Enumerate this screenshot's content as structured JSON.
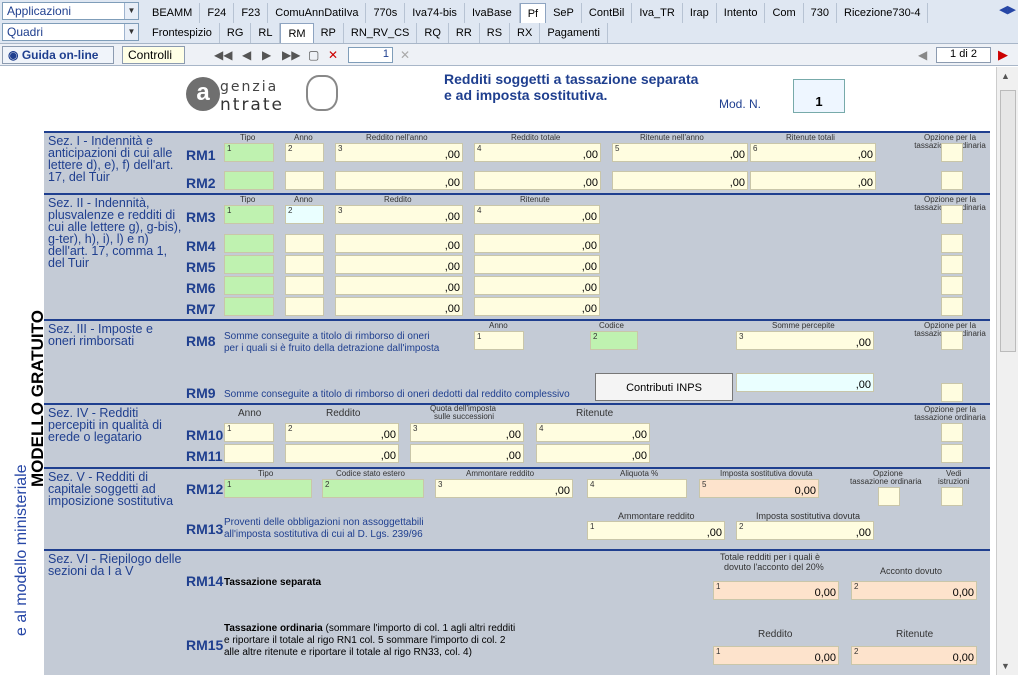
{
  "topbar": {
    "combo1": "Applicazioni",
    "combo2": "Quadri",
    "row1": [
      "BEAMM",
      "F24",
      "F23",
      "ComuAnnDatiIva",
      "770s",
      "Iva74-bis",
      "IvaBase",
      "Pf",
      "SeP",
      "ContBil",
      "Iva_TR",
      "Irap",
      "Intento",
      "Com",
      "730",
      "Ricezione730-4"
    ],
    "row1_active": "Pf",
    "row2": [
      "Frontespizio",
      "RG",
      "RL",
      "RM",
      "RP",
      "RN_RV_CS",
      "RQ",
      "RR",
      "RS",
      "RX",
      "Pagamenti"
    ],
    "row2_active": "RM"
  },
  "toolbar": {
    "guida": "Guida on-line",
    "controlli": "Controlli",
    "page_value": "1",
    "page_count": "1 di 2"
  },
  "sidebar": {
    "vertical_main": "MODELLO GRATUITO",
    "vertical_link": "e al modello ministeriale"
  },
  "header": {
    "logo_line1": "genzia",
    "logo_line2": "ntrate",
    "title_line1": "Redditi soggetti a tassazione separata",
    "title_line2": "e ad imposta sostitutiva.",
    "mod_label": "Mod. N.",
    "mod_value": "1"
  },
  "sez1": {
    "title": "Sez. I - Indennità e anticipazioni di cui alle lettere d), e), f) dell'art. 17, del Tuir",
    "cols": [
      "Tipo",
      "Anno",
      "Reddito nell'anno",
      "Reddito totale",
      "Ritenute nell'anno",
      "Ritenute totali",
      "Opzione per la tassazione ordinaria"
    ],
    "rows": [
      "RM1",
      "RM2"
    ]
  },
  "sez2": {
    "title": "Sez. II - Indennità, plusvalenze e redditi di cui alle lettere g), g-bis), g-ter), h), i), l) e n) dell'art. 17, comma 1, del Tuir",
    "cols": [
      "Tipo",
      "Anno",
      "Reddito",
      "Ritenute",
      "Opzione per la tassazione ordinaria"
    ],
    "rows": [
      "RM3",
      "RM4",
      "RM5",
      "RM6",
      "RM7"
    ]
  },
  "sez3": {
    "title": "Sez. III - Imposte e oneri rimborsati",
    "rm8_desc1": "Somme conseguite a titolo di rimborso di oneri",
    "rm8_desc2": "per i quali si è fruito della detrazione dall'imposta",
    "cols": [
      "Anno",
      "Codice",
      "Somme percepite",
      "Opzione per la tassazione ordinaria"
    ],
    "rm9_desc": "Somme conseguite a titolo di rimborso di oneri dedotti dal reddito complessivo",
    "inps_button": "Contributi INPS",
    "rows": [
      "RM8",
      "RM9"
    ]
  },
  "sez4": {
    "title": "Sez. IV - Redditi percepiti in qualità di erede o legatario",
    "cols": [
      "Anno",
      "Reddito",
      "Quota dell'imposta",
      "sulle successioni",
      "Ritenute",
      "Opzione per la tassazione ordinaria"
    ],
    "rows": [
      "RM10",
      "RM11"
    ]
  },
  "sez5": {
    "title": "Sez. V - Redditi di capitale soggetti ad imposizione sostitutiva",
    "cols": [
      "Tipo",
      "Codice stato estero",
      "Ammontare reddito",
      "Aliquota %",
      "Imposta sostitutiva dovuta",
      "Opzione",
      "tassazione ordinaria",
      "Vedi",
      "istruzioni"
    ],
    "rm13_desc1": "Proventi delle obbligazioni non assoggettabili",
    "rm13_desc2": "all'imposta sostitutiva di cui al D. Lgs. 239/96",
    "rm13_cols": [
      "Ammontare reddito",
      "Imposta sostitutiva dovuta"
    ],
    "rows": [
      "RM12",
      "RM13"
    ]
  },
  "sez6": {
    "title": "Sez. VI - Riepilogo delle sezioni da I a V",
    "rm14_desc": "Tassazione separata",
    "rm14_cols": [
      "Totale redditi per i quali è",
      "dovuto l'acconto del 20%",
      "Acconto dovuto"
    ],
    "rm15_bold": "Tassazione ordinaria",
    "rm15_desc1": " (sommare l'importo di col. 1 agli altri redditi",
    "rm15_desc2": "e riportare il totale al rigo RN1 col. 5 sommare l'importo di col. 2",
    "rm15_desc3": "alle altre ritenute e riportare il totale al rigo RN33, col. 4)",
    "rm15_cols": [
      "Reddito",
      "Ritenute"
    ],
    "rows": [
      "RM14",
      "RM15"
    ]
  },
  "values": {
    "dec": ",00",
    "zero": "0",
    "zero_dec": "0,00"
  }
}
